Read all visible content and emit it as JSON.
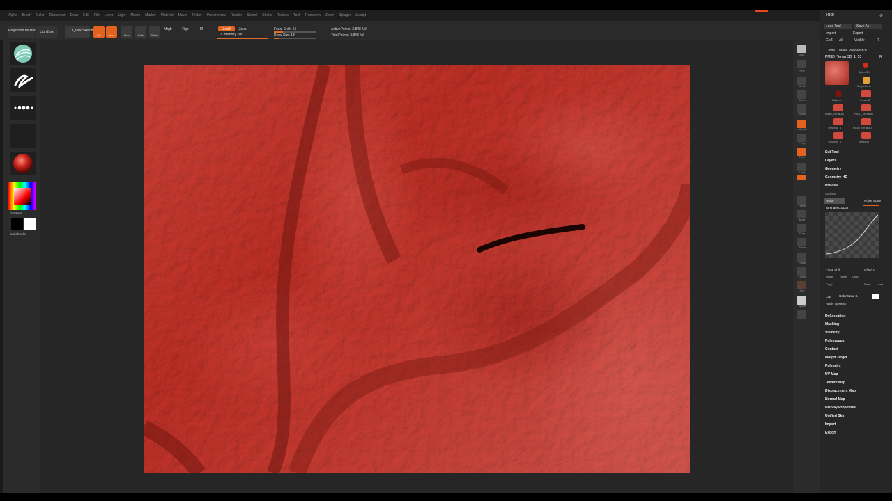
{
  "menu": {
    "items": [
      "Alpha",
      "Brush",
      "Color",
      "Document",
      "Draw",
      "Edit",
      "File",
      "Layer",
      "Light",
      "Macro",
      "Marker",
      "Material",
      "Movie",
      "Picker",
      "Preferences",
      "Render",
      "Stencil",
      "Stroke",
      "Texture",
      "Tool",
      "Transform",
      "Zoom",
      "Zplugin",
      "Zscript"
    ]
  },
  "toolbar": {
    "projection_master": "Projection Master",
    "lightbox": "LightBox",
    "quick_sketch": "Quick Sketch",
    "edit": "Edit",
    "draw": "Draw",
    "move": "Move",
    "scale": "Scale",
    "rotate": "Rotate",
    "mrgb": "Mrgb",
    "rgb": "Rgb",
    "m": "M",
    "zadd": "Zadd",
    "zsub": "Zsub",
    "z_intensity": "Z Intensity 100",
    "focal_shift": "Focal Shift -56",
    "draw_size": "Draw Size 18",
    "active_points": "ActivePoints: 3.848 Mil",
    "total_points": "TotalPoints: 3.848 Mil",
    "z_intensity_level": 1.0,
    "focal_shift_level": 0.22,
    "draw_size_level": 0.12
  },
  "left_shelf": {
    "gradient_label": "Gradient",
    "switch_color_label": "SwitchColor"
  },
  "right_icons": {
    "labels": [
      "BPR",
      "SPix",
      "Scroll",
      "Zoom",
      "Actual",
      "AAHalf",
      "Persp",
      "Floor",
      "Local",
      "Frame",
      "Move",
      "Scale",
      "Rotate",
      "Transp",
      "Ghost",
      "Solo",
      "Xpose"
    ]
  },
  "tool_palette": {
    "title": "Tool",
    "load_tool": "Load Tool",
    "save_as": "Save As",
    "import": "Import",
    "export": "Export",
    "goz": "GoZ",
    "all": "All",
    "visible": "Visible",
    "r": "R",
    "clone": "Clone",
    "make_polymesh": "Make PolyMesh3D",
    "current_tool": "PM3D_Terrain3D_1. 53",
    "r2": "R",
    "thumbs": [
      "Sphere3D",
      "SimpleBrush",
      "ZSphere",
      "Terrain3D",
      "PM3D_Terrain3D",
      "PM3D_Terrain3D",
      "Terrain3D_1",
      "PM3D_Terrain3D",
      "Terrain3D_1",
      "Terrain3D"
    ],
    "sections_top": [
      "SubTool",
      "Layers",
      "Geometry",
      "Geometry HD",
      "Preview"
    ],
    "surface": "Surface",
    "noise": "Noise",
    "noise_scale": "Noise Scale",
    "strength": "Strength 0.0103",
    "noise_curve": "Noise Curve",
    "focal_shift": "Focal Shift",
    "offset": "Offset 0",
    "noise_label": "Noise",
    "reset": "Reset",
    "undo": "Undo",
    "copy": "Copy",
    "save": "Save",
    "load": "Load",
    "lab": "LaB",
    "colorblend": "ColorBlend 0.",
    "apply_to_mesh": "Apply To Mesh",
    "sections_bottom": [
      "Deformation",
      "Masking",
      "Visibility",
      "Polygroups",
      "Contact",
      "Morph Target",
      "Polypaint",
      "UV Map",
      "Texture Map",
      "Displacement Map",
      "Normal Map",
      "Display Properties",
      "Unified Skin",
      "Import",
      "Export"
    ]
  },
  "colors": {
    "accent": "#e2621e",
    "background": "#2b2b2b",
    "canvas": "#262626",
    "surface_red": "#c9473e"
  }
}
